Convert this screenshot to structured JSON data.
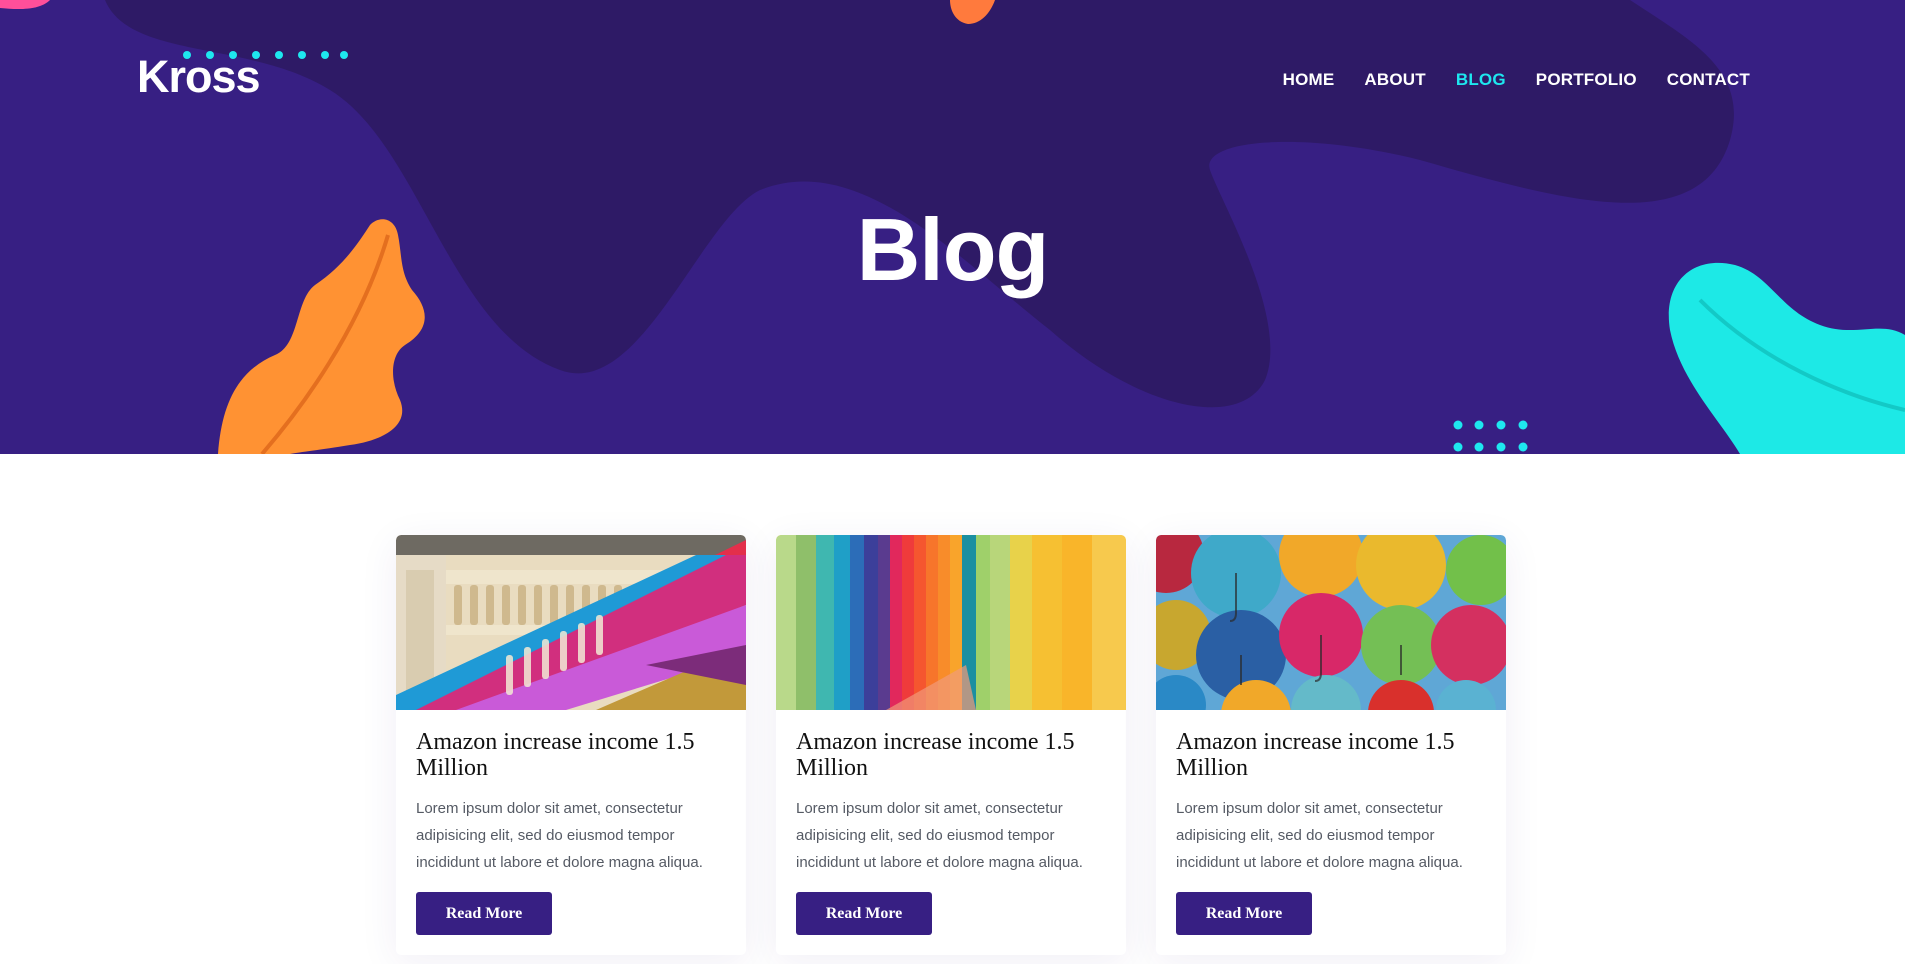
{
  "brand": {
    "name": "Kross"
  },
  "nav": {
    "items": [
      {
        "label": "HOME",
        "active": false
      },
      {
        "label": "ABOUT",
        "active": false
      },
      {
        "label": "BLOG",
        "active": true
      },
      {
        "label": "PORTFOLIO",
        "active": false
      },
      {
        "label": "CONTACT",
        "active": false
      }
    ]
  },
  "hero": {
    "title": "Blog"
  },
  "posts": [
    {
      "image": "colorful-staircase-railing",
      "title": "Amazon increase income 1.5 Million",
      "excerpt": "Lorem ipsum dolor sit amet, consectetur adipisicing elit, sed do eiusmod tempor incididunt ut labore et dolore magna aliqua.",
      "button": "Read More"
    },
    {
      "image": "rainbow-corridor",
      "title": "Amazon increase income 1.5 Million",
      "excerpt": "Lorem ipsum dolor sit amet, consectetur adipisicing elit, sed do eiusmod tempor incididunt ut labore et dolore magna aliqua.",
      "button": "Read More"
    },
    {
      "image": "colorful-umbrellas",
      "title": "Amazon increase income 1.5 Million",
      "excerpt": "Lorem ipsum dolor sit amet, consectetur adipisicing elit, sed do eiusmod tempor incididunt ut labore et dolore magna aliqua.",
      "button": "Read More"
    }
  ],
  "colors": {
    "hero_bg": "#371f83",
    "hero_blob": "#2e1a66",
    "accent_cyan": "#1ee7ef",
    "accent_orange": "#ff9233",
    "button_bg": "#371f83"
  }
}
